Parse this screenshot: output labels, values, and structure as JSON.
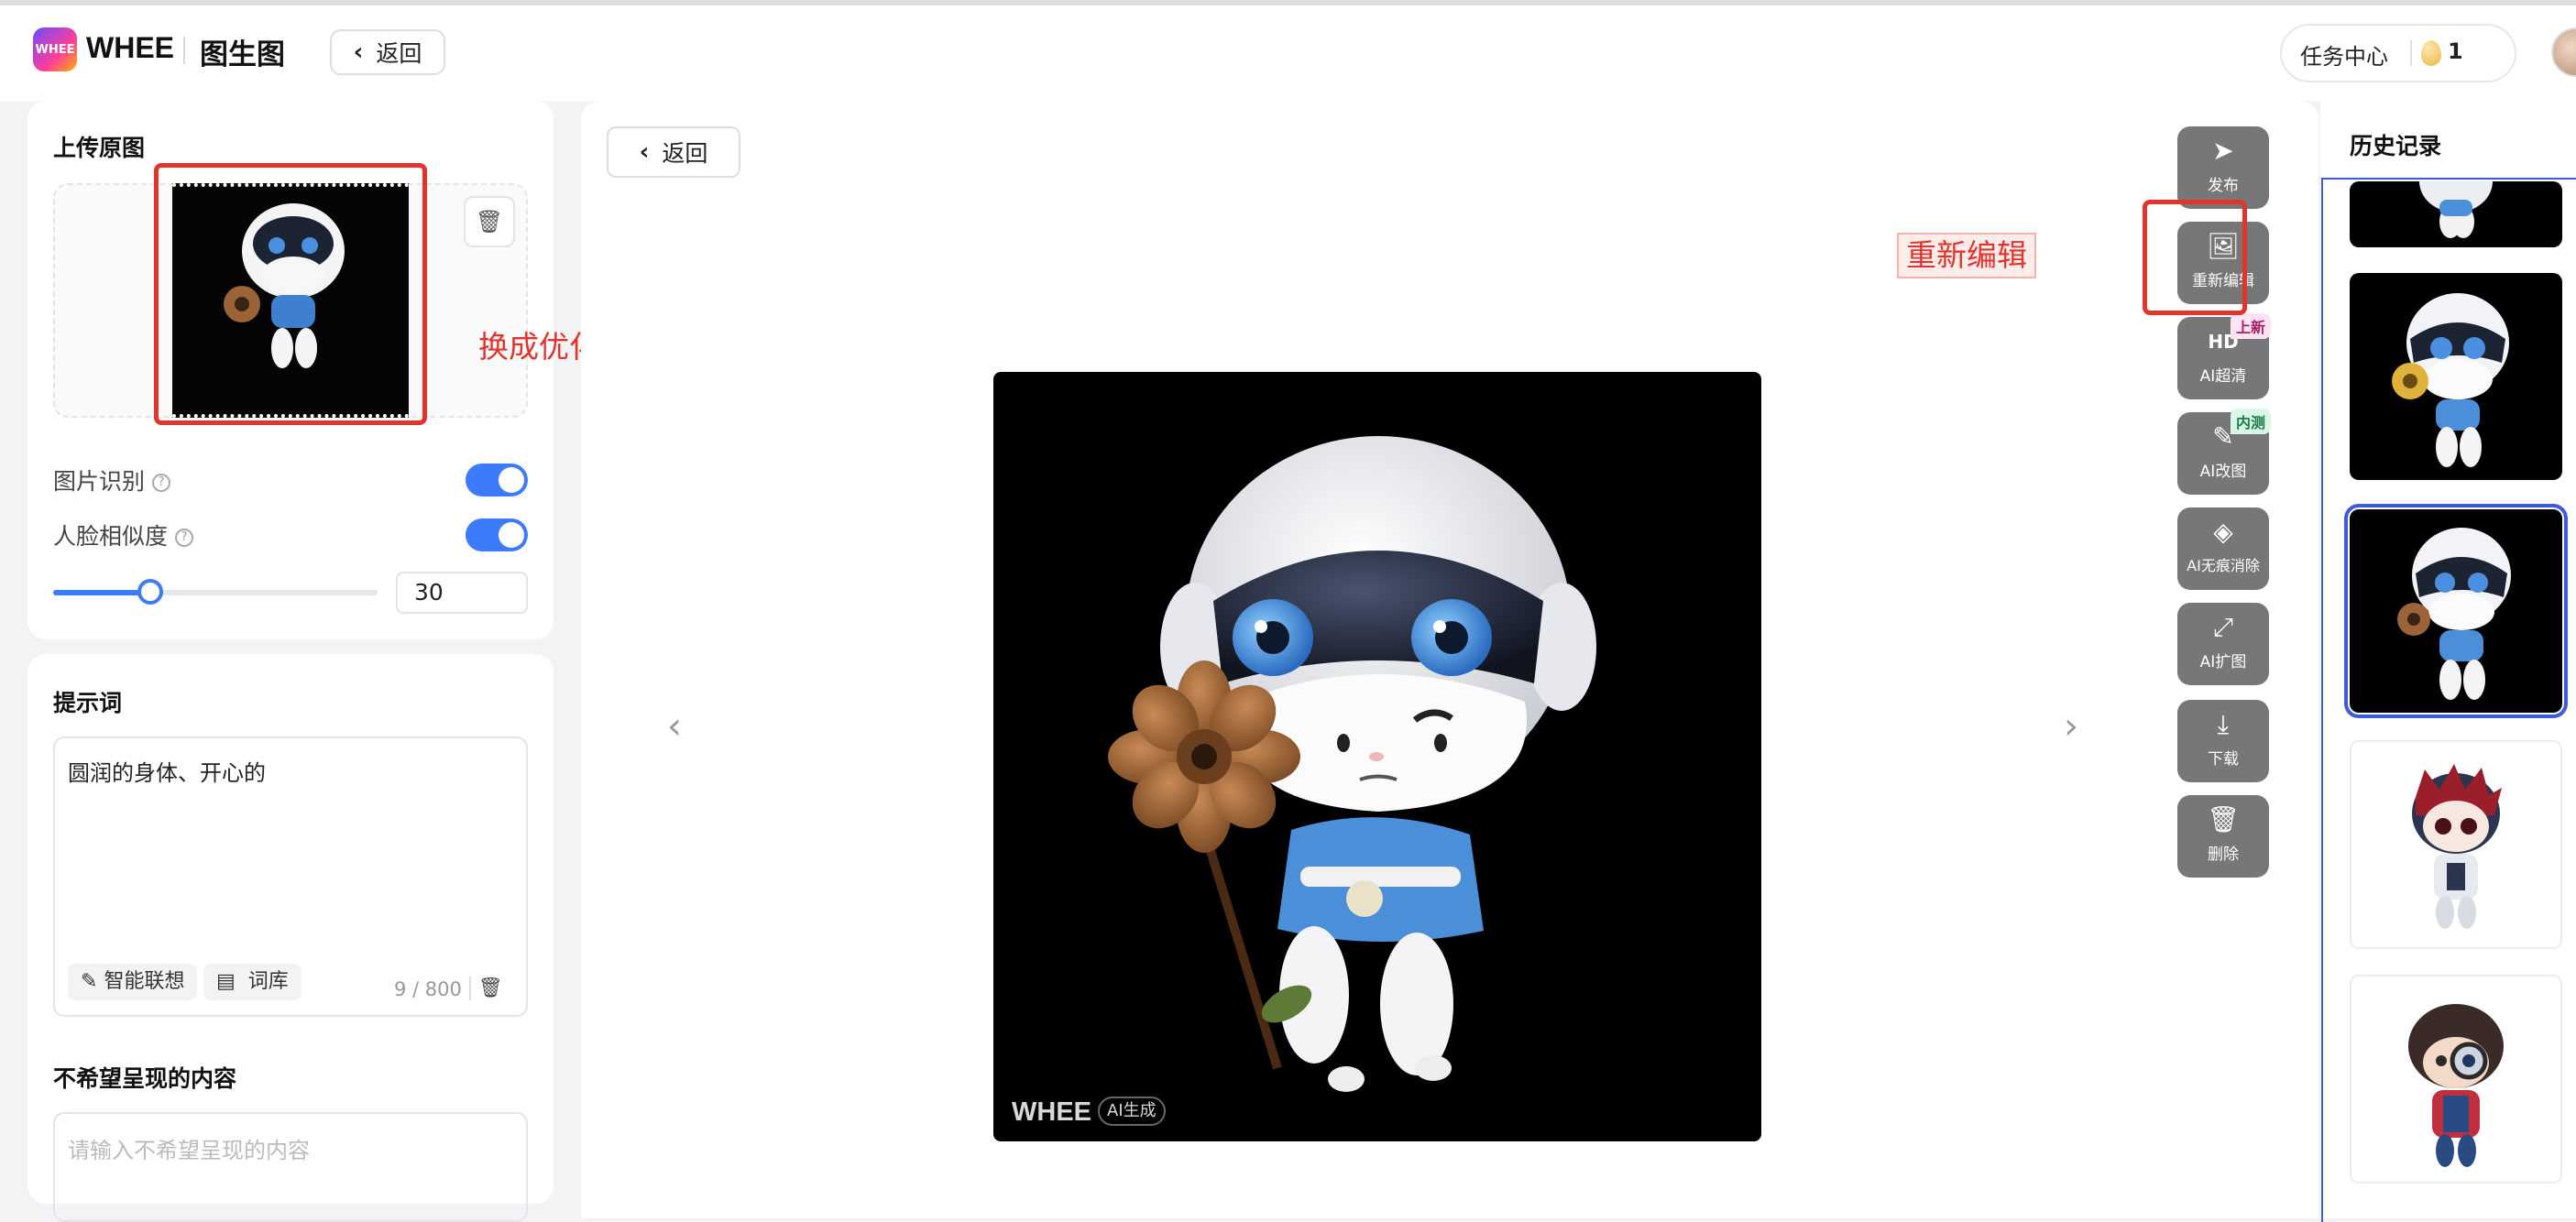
{
  "header": {
    "logo_text": "WHEE",
    "brand": "WHEE",
    "page_title": "图生图",
    "back_label": "返回",
    "task_center_label": "任务中心",
    "credits": "1"
  },
  "upload_panel": {
    "title": "上传原图",
    "annotation": "换成优化后的图片",
    "image_recognition_label": "图片识别",
    "image_recognition_on": true,
    "face_similarity_label": "人脸相似度",
    "face_similarity_on": true,
    "face_similarity_value": "30",
    "slider_fraction": 0.3
  },
  "prompt_panel": {
    "title": "提示词",
    "prompt_text": "圆润的身体、开心的",
    "smart_suggest_label": "智能联想",
    "lexicon_label": "词库",
    "counter": "9 / 800",
    "negative_title": "不希望呈现的内容",
    "negative_placeholder": "请输入不希望呈现的内容"
  },
  "canvas": {
    "back_label": "返回",
    "prev_glyph": "‹",
    "next_glyph": "›",
    "annotation": "重新编辑",
    "watermark": "WHEE",
    "watermark_tag": "AI生成"
  },
  "toolbar": {
    "items": [
      {
        "label": "发布",
        "icon": "send-icon",
        "glyph": "➤"
      },
      {
        "label": "重新编辑",
        "icon": "image-edit-icon",
        "glyph": "🖼"
      },
      {
        "label": "AI超清",
        "icon": "hd-icon",
        "glyph": "HD",
        "badge": "上新"
      },
      {
        "label": "AI改图",
        "icon": "brush-icon",
        "glyph": "✎",
        "badge": "内测"
      },
      {
        "label": "AI无痕消除",
        "icon": "eraser-icon",
        "glyph": "◈"
      },
      {
        "label": "AI扩图",
        "icon": "expand-icon",
        "glyph": "⤢"
      },
      {
        "label": "下载",
        "icon": "download-icon",
        "glyph": "⤓"
      },
      {
        "label": "删除",
        "icon": "trash-icon",
        "glyph": "🗑"
      }
    ]
  },
  "history": {
    "title": "历史记录"
  },
  "colors": {
    "accent": "#3d7bfd",
    "annotation_red": "#e2342c",
    "selection_blue": "#3d5bd9",
    "toolbar_gray": "#777779"
  }
}
